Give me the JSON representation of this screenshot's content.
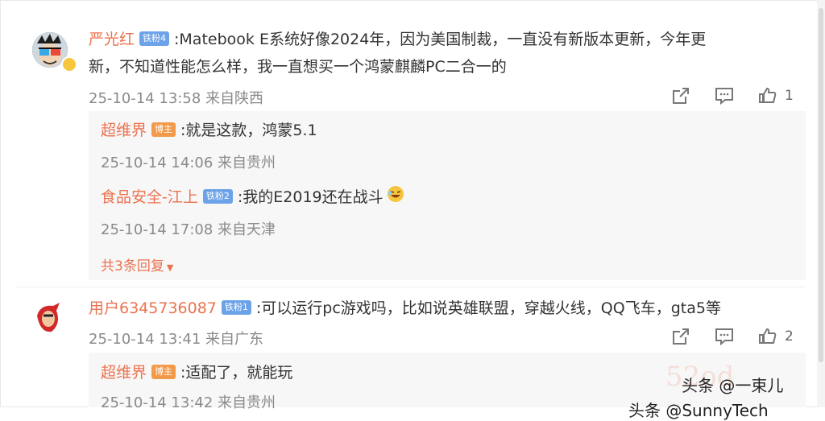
{
  "comments": [
    {
      "username": "严光红",
      "badge": "铁粉4",
      "text_line1": ":Matebook E系统好像2024年，因为美国制裁，一直没有新版本更新，今年更",
      "text_line2": "新，不知道性能怎么样，我一直想买一个鸿蒙麒麟PC二合一的",
      "time": "25-10-14 13:58 来自陕西",
      "likes": "1",
      "replies": [
        {
          "username": "超维界",
          "badge": "博主",
          "text": ":就是这款，鸿蒙5.1",
          "time": "25-10-14 14:06 来自贵州"
        },
        {
          "username": "食品安全-江上",
          "badge": "铁粉2",
          "text": ":我的E2019还在战斗",
          "time": "25-10-14 17:08 来自天津"
        }
      ],
      "more_replies": "共3条回复"
    },
    {
      "username": "用户6345736087",
      "badge": "铁粉1",
      "text": ":可以运行pc游戏吗，比如说英雄联盟，穿越火线，QQ飞车，gta5等",
      "time": "25-10-14 13:41 来自广东",
      "likes": "2",
      "replies": [
        {
          "username": "超维界",
          "badge": "博主",
          "text": ":适配了，就能玩",
          "time": "25-10-14 13:42 来自贵州"
        }
      ]
    }
  ],
  "watermark": {
    "line1": "头条 @一束儿",
    "line2": "头条 @SunnyTech",
    "faint": "52od"
  },
  "colors": {
    "username": "#eb7350",
    "badge_blue": "#6ba2e8",
    "badge_orange": "#f39a4a"
  }
}
